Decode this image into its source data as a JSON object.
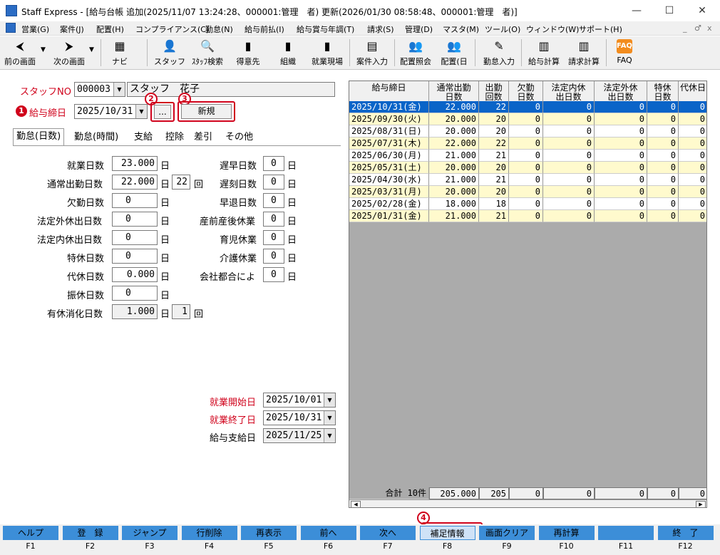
{
  "window": {
    "title": "Staff Express - [給与台帳 追加(2025/11/07 13:24:28、000001:管理　者) 更新(2026/01/30 08:58:48、000001:管理　者)]",
    "controls": [
      "—",
      "☐",
      "✕"
    ]
  },
  "menu": {
    "items": [
      "営業(G)",
      "案件(J)",
      "配置(H)",
      "コンプライアンス(C)",
      "勤怠(N)",
      "給与前払(I)",
      "給与賞与年調(T)",
      "請求(S)",
      "管理(D)",
      "マスタ(M)",
      "ツール(O)",
      "ウィンドウ(W)",
      "サポート(H)"
    ],
    "right": [
      "_",
      "♂",
      "x"
    ]
  },
  "toolbar": {
    "prev": "前の画面",
    "next": "次の画面",
    "navi": "ナビ",
    "staff": "スタッフ",
    "staff_search": "ｽﾀｯﾌ検索",
    "client": "得意先",
    "org": "組織",
    "worksite": "就業現場",
    "case_input": "案件入力",
    "assign_inquiry": "配置照会",
    "assign": "配置(日",
    "attendance_input": "勤怠入力",
    "payroll_calc": "給与計算",
    "billing_calc": "請求計算",
    "faq": "FAQ"
  },
  "form": {
    "staff_no_label": "スタッフNO",
    "staff_no": "000003",
    "staff_name": "スタッフ　花子",
    "pay_close_label": "給与締日",
    "pay_close_date": "2025/10/31",
    "ellipsis_button": "...",
    "new_button": "新規",
    "markers": [
      "1",
      "2",
      "3",
      "4"
    ],
    "tabs": [
      "勤怠(日数)",
      "勤怠(時間)",
      "支給",
      "控除",
      "差引",
      "その他"
    ],
    "unit_day": "日",
    "unit_times": "回",
    "left_fields": [
      {
        "label": "就業日数",
        "value": "23.000",
        "unit": "日"
      },
      {
        "label": "通常出勤日数",
        "value": "22.000",
        "unit": "日",
        "extra_value": "22",
        "extra_unit": "回"
      },
      {
        "label": "欠勤日数",
        "value": "0",
        "unit": "日"
      },
      {
        "label": "法定外休出日数",
        "value": "0",
        "unit": "日"
      },
      {
        "label": "法定内休出日数",
        "value": "0",
        "unit": "日"
      },
      {
        "label": "特休日数",
        "value": "0",
        "unit": "日"
      },
      {
        "label": "代休日数",
        "value": "0.000",
        "unit": "日"
      },
      {
        "label": "振休日数",
        "value": "0",
        "unit": "日"
      },
      {
        "label": "有休消化日数",
        "value": "1.000",
        "unit": "日",
        "extra_value": "1",
        "extra_unit": "回"
      }
    ],
    "right_fields": [
      {
        "label": "遅早日数",
        "value": "0",
        "unit": "日"
      },
      {
        "label": "遅刻日数",
        "value": "0",
        "unit": "日"
      },
      {
        "label": "早退日数",
        "value": "0",
        "unit": "日"
      },
      {
        "label": "産前産後休業",
        "value": "0",
        "unit": "日"
      },
      {
        "label": "育児休業",
        "value": "0",
        "unit": "日"
      },
      {
        "label": "介護休業",
        "value": "0",
        "unit": "日"
      },
      {
        "label": "会社都合によ",
        "value": "0",
        "unit": "日"
      }
    ],
    "work_start_label": "就業開始日",
    "work_start": "2025/10/01",
    "work_end_label": "就業終了日",
    "work_end": "2025/10/31",
    "pay_date_label": "給与支給日",
    "pay_date": "2025/11/25"
  },
  "grid": {
    "headers": [
      "給与締日",
      "通常出勤\n日数",
      "出勤\n回数",
      "欠勤\n日数",
      "法定内休\n出日数",
      "法定外休\n出日数",
      "特休\n日数",
      "代休日"
    ],
    "rows": [
      [
        "2025/10/31(金)",
        "22.000",
        "22",
        "0",
        "0",
        "0",
        "0",
        "0"
      ],
      [
        "2025/09/30(火)",
        "20.000",
        "20",
        "0",
        "0",
        "0",
        "0",
        "0"
      ],
      [
        "2025/08/31(日)",
        "20.000",
        "20",
        "0",
        "0",
        "0",
        "0",
        "0"
      ],
      [
        "2025/07/31(木)",
        "22.000",
        "22",
        "0",
        "0",
        "0",
        "0",
        "0"
      ],
      [
        "2025/06/30(月)",
        "21.000",
        "21",
        "0",
        "0",
        "0",
        "0",
        "0"
      ],
      [
        "2025/05/31(土)",
        "20.000",
        "20",
        "0",
        "0",
        "0",
        "0",
        "0"
      ],
      [
        "2025/04/30(水)",
        "21.000",
        "21",
        "0",
        "0",
        "0",
        "0",
        "0"
      ],
      [
        "2025/03/31(月)",
        "20.000",
        "20",
        "0",
        "0",
        "0",
        "0",
        "0"
      ],
      [
        "2025/02/28(金)",
        "18.000",
        "18",
        "0",
        "0",
        "0",
        "0",
        "0"
      ],
      [
        "2025/01/31(金)",
        "21.000",
        "21",
        "0",
        "0",
        "0",
        "0",
        "0"
      ]
    ],
    "total_label": "合計 10件",
    "totals": [
      "205.000",
      "205",
      "0",
      "0",
      "0",
      "0",
      "0"
    ]
  },
  "fkeys": [
    {
      "label": "ヘルプ",
      "key": "F1"
    },
    {
      "label": "登　録",
      "key": "F2"
    },
    {
      "label": "ジャンプ",
      "key": "F3"
    },
    {
      "label": "行削除",
      "key": "F4"
    },
    {
      "label": "再表示",
      "key": "F5"
    },
    {
      "label": "前へ",
      "key": "F6"
    },
    {
      "label": "次へ",
      "key": "F7"
    },
    {
      "label": "補足情報",
      "key": "F8"
    },
    {
      "label": "画面クリア",
      "key": "F9"
    },
    {
      "label": "再計算",
      "key": "F10"
    },
    {
      "label": "",
      "key": "F11"
    },
    {
      "label": "終　了",
      "key": "F12"
    }
  ],
  "colors": {
    "accent_red": "#d0021b",
    "row_selected": "#0a64c8",
    "row_yellow": "#fffacd",
    "fkey_blue": "#3c8ed8"
  }
}
